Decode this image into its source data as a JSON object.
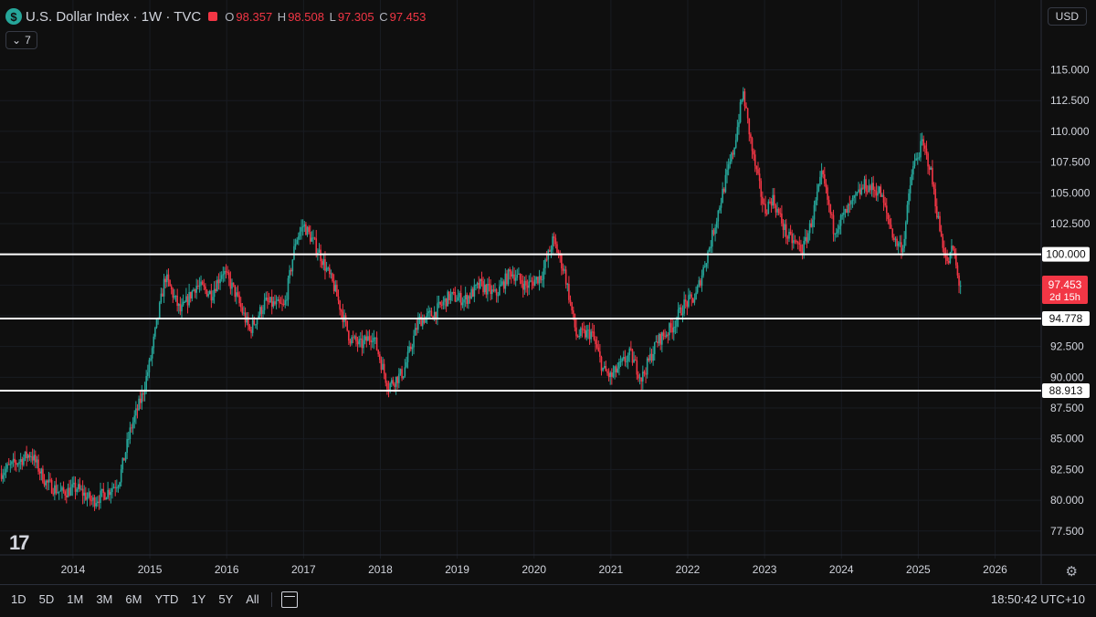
{
  "header": {
    "title": "U.S. Dollar Index · 1W · TVC",
    "logo_glyph": "$",
    "ohlc": {
      "o_label": "O",
      "o": "98.357",
      "h_label": "H",
      "h": "98.508",
      "l_label": "L",
      "l": "97.305",
      "c_label": "C",
      "c": "97.453"
    },
    "indicators_count": "7",
    "currency": "USD"
  },
  "colors": {
    "up": "#26a69a",
    "down": "#f23645",
    "bg": "#0f0f0f",
    "text": "#d1d4dc",
    "grid": "#1c1f26",
    "level": "#ffffff"
  },
  "chart_data": {
    "type": "candlestick",
    "title": "U.S. Dollar Index",
    "interval": "1W",
    "xlim": [
      2013.05,
      2026.6
    ],
    "ylim": [
      75.7,
      116.6
    ],
    "y_ticks": [
      "77.500",
      "80.000",
      "82.500",
      "85.000",
      "87.500",
      "90.000",
      "92.500",
      "95.000",
      "97.500",
      "100.000",
      "102.500",
      "105.000",
      "107.500",
      "110.000",
      "112.500",
      "115.000"
    ],
    "y_tick_values": [
      77.5,
      80,
      82.5,
      85,
      87.5,
      90,
      92.5,
      95,
      97.5,
      100,
      102.5,
      105,
      107.5,
      110,
      112.5,
      115
    ],
    "x_ticks": [
      "2014",
      "2015",
      "2016",
      "2017",
      "2018",
      "2019",
      "2020",
      "2021",
      "2022",
      "2023",
      "2024",
      "2025",
      "2026"
    ],
    "x_tick_values": [
      2014,
      2015,
      2016,
      2017,
      2018,
      2019,
      2020,
      2021,
      2022,
      2023,
      2024,
      2025,
      2026
    ],
    "horizontal_levels": [
      {
        "value": 100.0,
        "label": "100.000"
      },
      {
        "value": 94.778,
        "label": "94.778"
      },
      {
        "value": 88.913,
        "label": "88.913"
      }
    ],
    "last_price": {
      "value": 97.453,
      "label": "97.453",
      "countdown": "2d 15h"
    },
    "close_path": [
      [
        2013.05,
        82.2
      ],
      [
        2013.25,
        83.0
      ],
      [
        2013.45,
        83.8
      ],
      [
        2013.65,
        81.4
      ],
      [
        2013.85,
        80.6
      ],
      [
        2014.05,
        81.0
      ],
      [
        2014.25,
        79.9
      ],
      [
        2014.45,
        80.7
      ],
      [
        2014.6,
        81.6
      ],
      [
        2014.75,
        85.8
      ],
      [
        2014.9,
        88.5
      ],
      [
        2015.0,
        91.2
      ],
      [
        2015.2,
        98.2
      ],
      [
        2015.4,
        95.3
      ],
      [
        2015.6,
        97.5
      ],
      [
        2015.8,
        96.8
      ],
      [
        2015.95,
        98.7
      ],
      [
        2016.1,
        97.0
      ],
      [
        2016.3,
        93.8
      ],
      [
        2016.5,
        96.1
      ],
      [
        2016.75,
        95.7
      ],
      [
        2016.9,
        101.2
      ],
      [
        2017.0,
        102.4
      ],
      [
        2017.2,
        100.2
      ],
      [
        2017.4,
        97.3
      ],
      [
        2017.6,
        93.2
      ],
      [
        2017.75,
        92.6
      ],
      [
        2017.9,
        93.5
      ],
      [
        2018.1,
        89.3
      ],
      [
        2018.3,
        90.4
      ],
      [
        2018.5,
        94.6
      ],
      [
        2018.7,
        95.2
      ],
      [
        2018.9,
        96.6
      ],
      [
        2019.1,
        96.3
      ],
      [
        2019.3,
        97.5
      ],
      [
        2019.5,
        96.7
      ],
      [
        2019.7,
        98.6
      ],
      [
        2019.9,
        97.4
      ],
      [
        2020.1,
        98.3
      ],
      [
        2020.25,
        101.2
      ],
      [
        2020.4,
        98.5
      ],
      [
        2020.55,
        93.4
      ],
      [
        2020.75,
        93.6
      ],
      [
        2020.9,
        90.6
      ],
      [
        2021.0,
        90.0
      ],
      [
        2021.25,
        91.9
      ],
      [
        2021.4,
        89.9
      ],
      [
        2021.6,
        92.9
      ],
      [
        2021.8,
        94.1
      ],
      [
        2021.95,
        95.9
      ],
      [
        2022.1,
        96.5
      ],
      [
        2022.3,
        101.0
      ],
      [
        2022.5,
        106.2
      ],
      [
        2022.6,
        108.6
      ],
      [
        2022.72,
        113.2
      ],
      [
        2022.85,
        108.0
      ],
      [
        2023.0,
        103.5
      ],
      [
        2023.1,
        104.6
      ],
      [
        2023.3,
        101.4
      ],
      [
        2023.5,
        100.4
      ],
      [
        2023.6,
        102.4
      ],
      [
        2023.75,
        106.5
      ],
      [
        2023.9,
        102.0
      ],
      [
        2024.05,
        103.3
      ],
      [
        2024.3,
        105.6
      ],
      [
        2024.5,
        105.1
      ],
      [
        2024.7,
        101.0
      ],
      [
        2024.8,
        100.6
      ],
      [
        2024.92,
        106.8
      ],
      [
        2025.05,
        109.0
      ],
      [
        2025.15,
        107.2
      ],
      [
        2025.28,
        102.0
      ],
      [
        2025.38,
        99.1
      ],
      [
        2025.45,
        100.6
      ],
      [
        2025.52,
        97.9
      ],
      [
        2025.55,
        97.45
      ]
    ]
  },
  "bottom_bar": {
    "ranges": [
      "1D",
      "5D",
      "1M",
      "3M",
      "6M",
      "YTD",
      "1Y",
      "5Y",
      "All"
    ],
    "clock": "18:50:42 UTC+10"
  },
  "icons": {
    "settings": "gear-icon",
    "calendar": "calendar-icon",
    "logo": "tradingview-logo"
  }
}
